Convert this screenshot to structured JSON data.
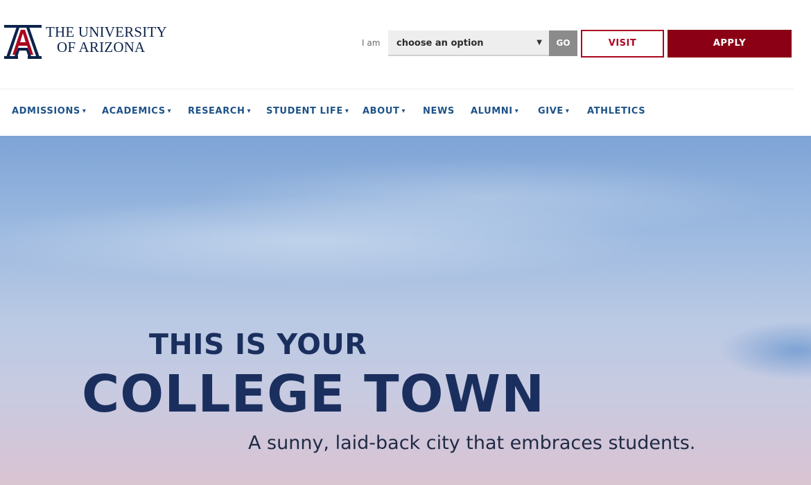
{
  "header": {
    "logo_line1": "THE UNIVERSITY",
    "logo_line2": "OF ARIZONA",
    "iam_label": "I am",
    "select_value": "choose an option",
    "go_label": "GO",
    "visit_label": "VISIT",
    "apply_label": "APPLY"
  },
  "nav": {
    "items": [
      {
        "label": "ADMISSIONS",
        "dropdown": true
      },
      {
        "label": "ACADEMICS",
        "dropdown": true
      },
      {
        "label": "RESEARCH",
        "dropdown": true
      },
      {
        "label": "STUDENT LIFE",
        "dropdown": true
      },
      {
        "label": "ABOUT",
        "dropdown": true
      },
      {
        "label": "NEWS",
        "dropdown": false
      },
      {
        "label": "ALUMNI",
        "dropdown": true
      },
      {
        "label": "GIVE",
        "dropdown": true
      },
      {
        "label": "ATHLETICS",
        "dropdown": false
      }
    ]
  },
  "hero": {
    "line1": "THIS IS YOUR",
    "line2": "COLLEGE TOWN",
    "subtitle": "A sunny, laid-back city that embraces students."
  },
  "colors": {
    "brand_navy": "#0c234b",
    "brand_red": "#ab0520",
    "nav_blue": "#1e5288",
    "apply_red": "#8b0015"
  },
  "icons": {
    "logo": "block-a-logo-icon",
    "dropdown": "caret-down-icon"
  }
}
